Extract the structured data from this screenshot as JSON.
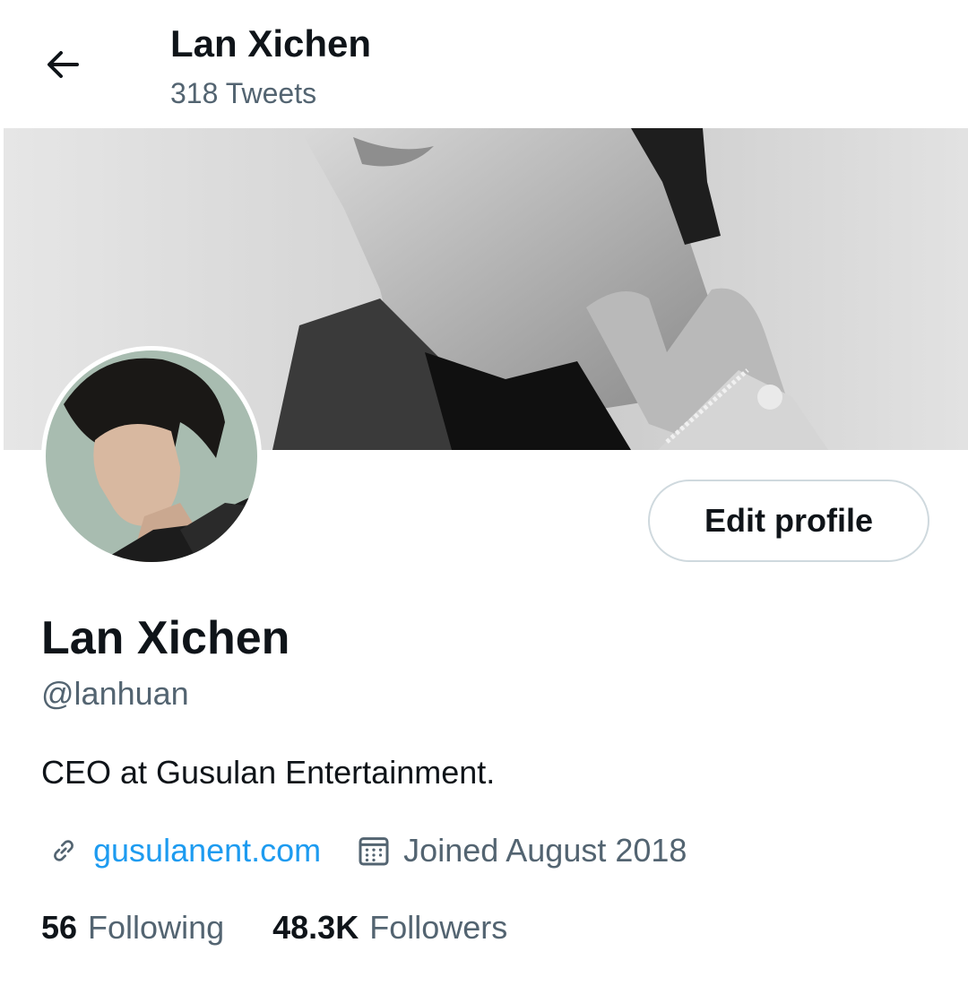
{
  "header": {
    "back_icon": "arrow-left-icon",
    "name": "Lan Xichen",
    "tweet_count": "318 Tweets"
  },
  "profile": {
    "display_name": "Lan Xichen",
    "handle": "@lanhuan",
    "bio": "CEO at Gusulan Entertainment.",
    "website": "gusulanent.com",
    "joined": "Joined August 2018",
    "link_icon": "link-icon",
    "calendar_icon": "calendar-icon",
    "edit_button_label": "Edit profile"
  },
  "stats": {
    "following_count": "56",
    "following_label": "Following",
    "followers_count": "48.3K",
    "followers_label": "Followers"
  },
  "colors": {
    "text_primary": "#0f1419",
    "text_secondary": "#536471",
    "link": "#1d9bf0",
    "border": "#cfd9de"
  }
}
